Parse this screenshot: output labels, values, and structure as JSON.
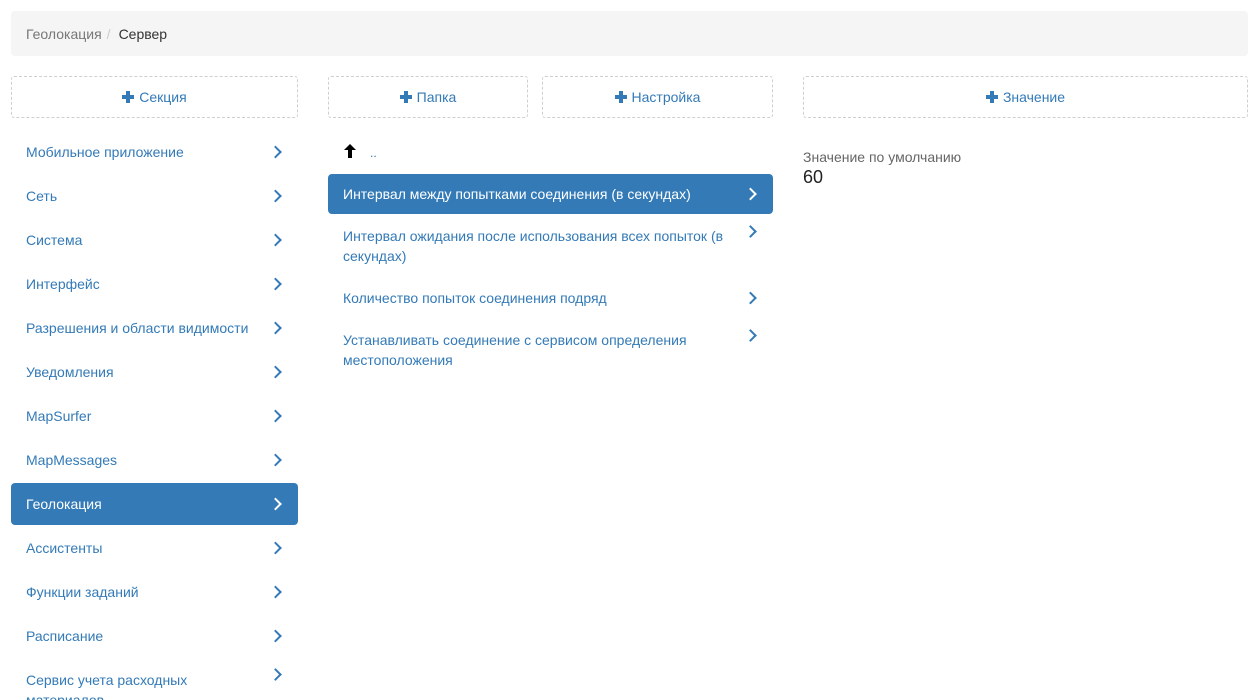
{
  "breadcrumb": {
    "parent": "Геолокация",
    "separator": "/",
    "current": "Сервер"
  },
  "buttons": {
    "section": "Секция",
    "folder": "Папка",
    "setting": "Настройка",
    "value": "Значение"
  },
  "sections": [
    {
      "label": "Мобильное приложение"
    },
    {
      "label": "Сеть"
    },
    {
      "label": "Система"
    },
    {
      "label": "Интерфейс"
    },
    {
      "label": "Разрешения и области видимости"
    },
    {
      "label": "Уведомления"
    },
    {
      "label": "MapSurfer"
    },
    {
      "label": "MapMessages"
    },
    {
      "label": "Геолокация"
    },
    {
      "label": "Ассистенты"
    },
    {
      "label": "Функции заданий"
    },
    {
      "label": "Расписание"
    },
    {
      "label": "Сервис учета расходных материалов"
    }
  ],
  "up_label": "..",
  "settings": [
    {
      "label": "Интервал между попытками соединения (в секундах)"
    },
    {
      "label": "Интервал ожидания после использования всех попыток (в секундах)"
    },
    {
      "label": "Количество попыток соединения подряд"
    },
    {
      "label": "Устанавливать соединение с сервисом определения местоположения"
    }
  ],
  "value_panel": {
    "label": "Значение по умолчанию",
    "value": "60"
  },
  "colors": {
    "accent": "#337ab7",
    "breadcrumb_bg": "#f5f5f5",
    "dashed_border": "#cfcfcf"
  },
  "icons": {
    "add": "plus-icon",
    "item": "chevron-right-icon",
    "up": "arrow-up-icon"
  }
}
